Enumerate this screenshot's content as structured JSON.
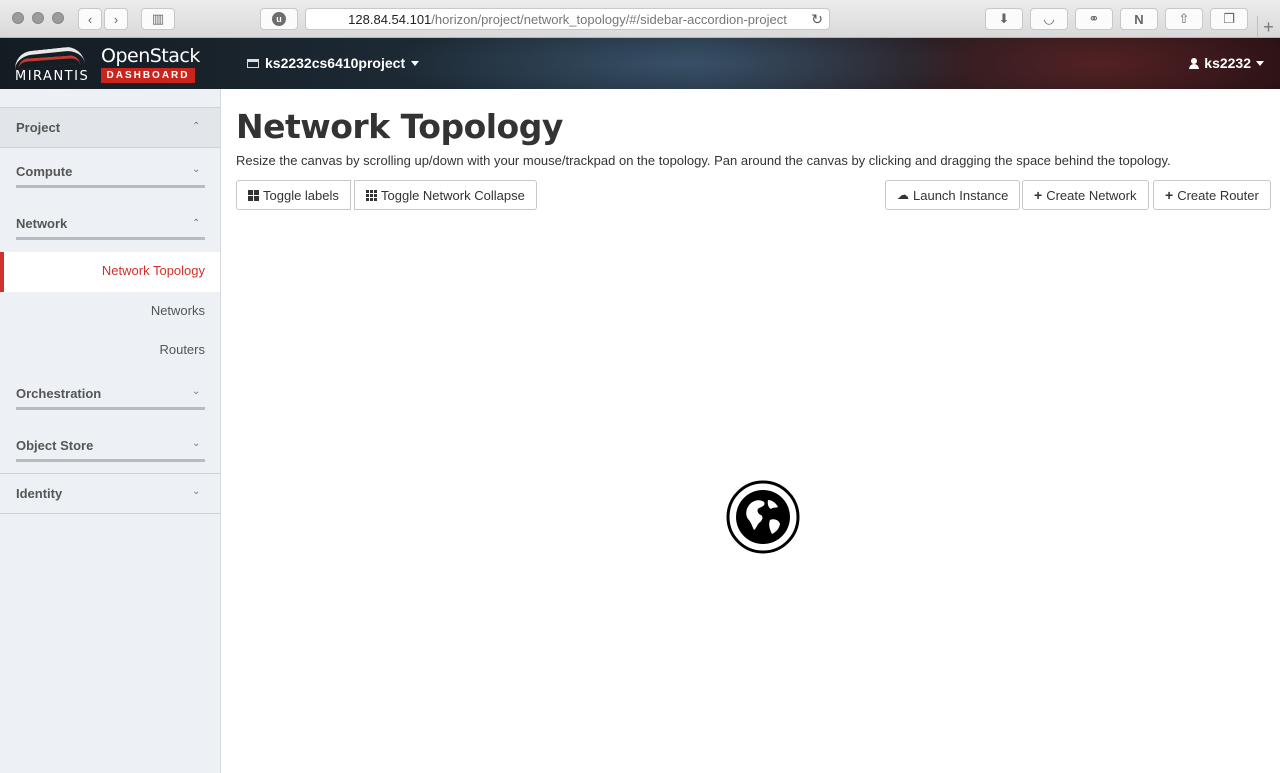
{
  "browser": {
    "url_host": "128.84.54.101",
    "url_path": "/horizon/project/network_topology/#/sidebar-accordion-project"
  },
  "header": {
    "logo_mirantis": "MIRANTIS",
    "logo_openstack": "OpenStack",
    "logo_dashboard": "DASHBOARD",
    "project": "ks2232cs6410project",
    "user": "ks2232"
  },
  "sidebar": {
    "project": "Project",
    "compute": "Compute",
    "network": "Network",
    "network_items": [
      "Network Topology",
      "Networks",
      "Routers"
    ],
    "orchestration": "Orchestration",
    "object_store": "Object Store",
    "identity": "Identity",
    "active_color": "#d0312d"
  },
  "main": {
    "title": "Network Topology",
    "help_text": "Resize the canvas by scrolling up/down with your mouse/trackpad on the topology. Pan around the canvas by clicking and dragging the space behind the topology.",
    "toggle_labels": "Toggle labels",
    "toggle_collapse": "Toggle Network Collapse",
    "launch_instance": "Launch Instance",
    "create_network": "Create Network",
    "create_router": "Create Router"
  }
}
